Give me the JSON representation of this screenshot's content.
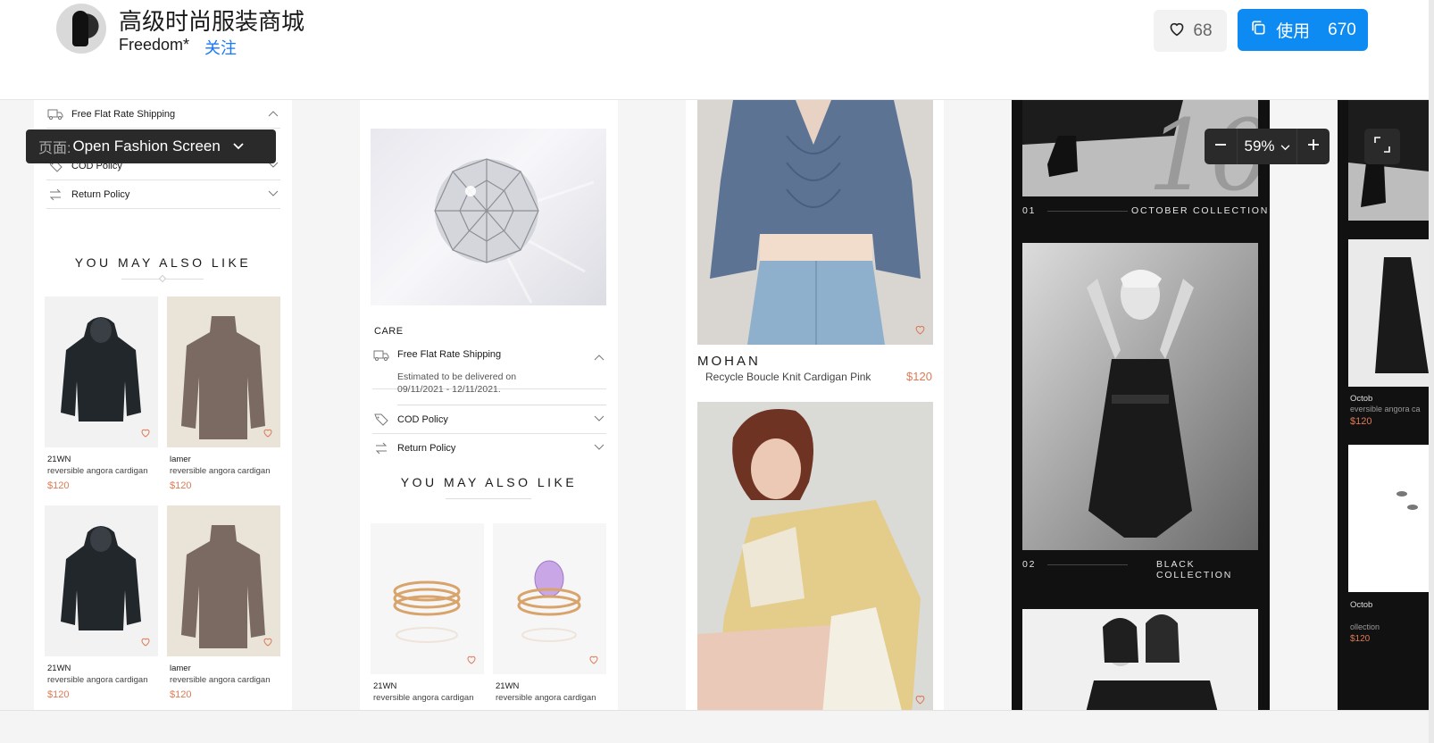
{
  "header": {
    "title": "高级时尚服装商城",
    "author": "Freedom*",
    "follow_label": "关注",
    "like_count": "68",
    "use_label": "使用",
    "use_count": "670",
    "accent_color": "#0d8bf2"
  },
  "toolbar": {
    "page_label": "页面:",
    "page_value": "Open Fashion Screen",
    "zoom_value": "59%"
  },
  "screen1": {
    "accordion": [
      "Free Flat Rate Shipping",
      "COD Policy",
      "Return Policy"
    ],
    "ymal_title": "YOU MAY ALSO LIKE",
    "products": [
      {
        "brand": "21WN",
        "desc": "reversible angora cardigan",
        "price": "$120"
      },
      {
        "brand": "lamer",
        "desc": "reversible angora cardigan",
        "price": "$120"
      },
      {
        "brand": "21WN",
        "desc": "reversible angora cardigan",
        "price": "$120"
      },
      {
        "brand": "lamer",
        "desc": "reversible angora cardigan",
        "price": "$120"
      }
    ]
  },
  "screen2": {
    "care_label": "CARE",
    "shipping_title": "Free Flat Rate Shipping",
    "shipping_line1": "Estimated to be delivered on",
    "shipping_line2": "09/11/2021 - 12/11/2021.",
    "cod_label": "COD Policy",
    "return_label": "Return Policy",
    "ymal_title": "YOU MAY ALSO LIKE",
    "products": [
      {
        "brand": "21WN",
        "desc": "reversible angora cardigan"
      },
      {
        "brand": "21WN",
        "desc": "reversible angora cardigan"
      }
    ]
  },
  "screen3": {
    "brand": "MOHAN",
    "desc": "Recycle Boucle Knit Cardigan Pink",
    "price": "$120"
  },
  "screen4": {
    "collections": [
      {
        "num": "01",
        "name": "OCTOBER COLLECTION"
      },
      {
        "num": "02",
        "name": "BLACK COLLECTION"
      }
    ]
  },
  "screen5": {
    "items": [
      {
        "title": "Octob",
        "sub": "eversible angora ca",
        "price": "$120"
      },
      {
        "title": "Octob",
        "sub": "ollection",
        "price": "$120"
      }
    ]
  }
}
